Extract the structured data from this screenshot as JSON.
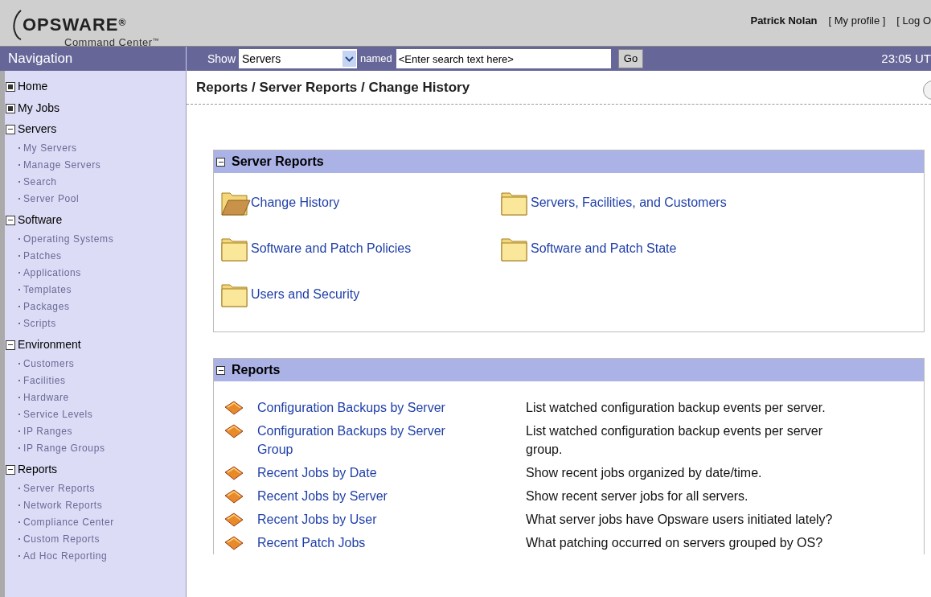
{
  "header": {
    "logo": "OPSWARE",
    "logo_mark": "®",
    "subtitle": "Command Center",
    "subtitle_mark": "™",
    "user": "Patrick Nolan",
    "links": [
      "[ My profile ]",
      "[ Log O"
    ]
  },
  "toolbar": {
    "nav_title": "Navigation",
    "show_label": "Show",
    "show_value": "Servers",
    "named_label": "named",
    "search_value": "<Enter search text here>",
    "go": "Go",
    "time": "23:05 UT"
  },
  "sidebar": {
    "items": [
      {
        "kind": "link",
        "label": "Home"
      },
      {
        "kind": "link",
        "label": "My Jobs"
      },
      {
        "kind": "group",
        "label": "Servers",
        "expanded": true,
        "children": [
          "My Servers",
          "Manage Servers",
          "Search",
          "Server Pool"
        ]
      },
      {
        "kind": "group",
        "label": "Software",
        "expanded": true,
        "children": [
          "Operating Systems",
          "Patches",
          "Applications",
          "Templates",
          "Packages",
          "Scripts"
        ]
      },
      {
        "kind": "group",
        "label": "Environment",
        "expanded": true,
        "children": [
          "Customers",
          "Facilities",
          "Hardware",
          "Service Levels",
          "IP Ranges",
          "IP Range Groups"
        ]
      },
      {
        "kind": "group",
        "label": "Reports",
        "expanded": true,
        "children": [
          "Server Reports",
          "Network Reports",
          "Compliance Center",
          "Custom Reports",
          "Ad Hoc Reporting"
        ]
      }
    ]
  },
  "breadcrumb": "Reports / Server Reports / Change History",
  "server_reports": {
    "title": "Server Reports",
    "expanded": true,
    "folders": [
      {
        "label": "Change History",
        "open": true
      },
      {
        "label": "Servers, Facilities, and Customers",
        "open": false
      },
      {
        "label": "Software and Patch Policies",
        "open": false
      },
      {
        "label": "Software and Patch State",
        "open": false
      },
      {
        "label": "Users and Security",
        "open": false
      }
    ]
  },
  "reports": {
    "title": "Reports",
    "expanded": true,
    "rows": [
      {
        "name": "Configuration Backups by Server",
        "description": "List watched configuration backup events per server."
      },
      {
        "name": "Configuration Backups by Server Group",
        "description": "List watched configuration backup events per server group."
      },
      {
        "name": "Recent Jobs by Date",
        "description": "Show recent jobs organized by date/time."
      },
      {
        "name": "Recent Jobs by Server",
        "description": "Show recent server jobs for all servers."
      },
      {
        "name": "Recent Jobs by User",
        "description": "What server jobs have Opsware users initiated lately?"
      },
      {
        "name": "Recent Patch Jobs",
        "description": "What patching occurred on servers grouped by OS?"
      }
    ]
  }
}
